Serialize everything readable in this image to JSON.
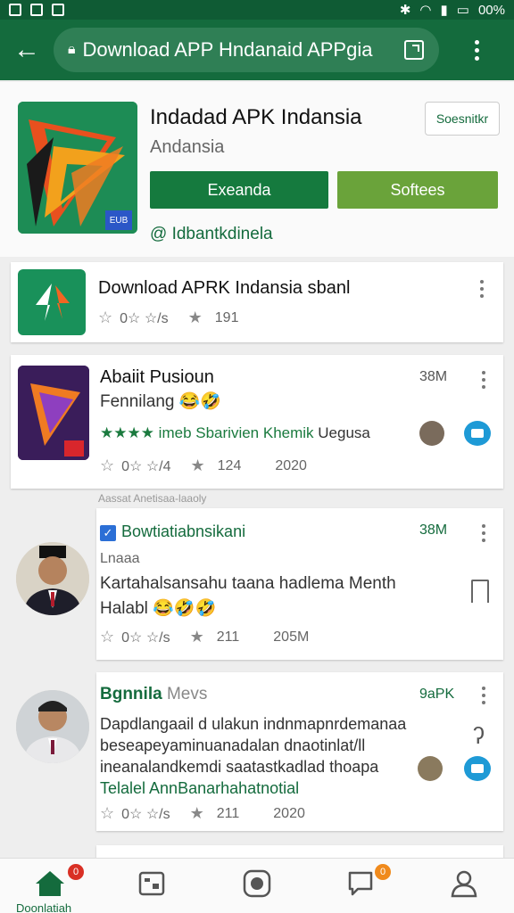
{
  "statusbar": {
    "right_text": "00%"
  },
  "appbar": {
    "url": "Download APP Hndanaid APPgia"
  },
  "header": {
    "title": "Indadad APK Indansia",
    "subtitle": "Andansia",
    "corner_button": "Soesnitkr",
    "primary_button": "Exeanda",
    "secondary_button": "Softees",
    "developer_link": "@ Idbantkdinela"
  },
  "cards": [
    {
      "title": "Download APRK Indansia sbanl",
      "rating_text": "0☆ ☆/s",
      "downloads": "191"
    },
    {
      "title": "Abaiit Pusioun",
      "size": "38M",
      "subtitle": "Fennilang",
      "emoji": "😂🤣",
      "promo": "★★★★ imeb Sbarivien Khemik",
      "promo_tail": "Uegusa",
      "rating_text": "0☆ ☆/4",
      "downloads": "124",
      "year": "2020"
    },
    {
      "title": "Bowtiatiabnsikani",
      "size": "38M",
      "label": "Lnaaa",
      "body_line1": "Kartahalsansahu taana hadlema Menth",
      "body_line2": "Halabl",
      "emoji": "😂🤣🤣",
      "rating_text": "0☆ ☆/s",
      "downloads": "211",
      "year": "205M"
    },
    {
      "title": "Bgnnila",
      "title_tail": "Mevs",
      "size": "9aPK",
      "body_line1": "Dapdlangaail d ulakun indnmapnrdemanaa",
      "body_line2": "beseapeyaminuanadalan dnaotinlat/ll",
      "body_line3": "ineanalandkemdi saatastkadlad thoapa",
      "body_line4": "Telalel AnnBanarhahatnotial",
      "rating_text": "0☆ ☆/s",
      "downloads": "211",
      "year": "2020"
    }
  ],
  "between_label": "Aassat Anetisaa-laaoly",
  "bottom_nav": {
    "home_label": "Doonlatiah",
    "home_badge": "0",
    "msg_badge": "0"
  },
  "colors": {
    "brand": "#146b3d",
    "primary_btn": "#157a3e",
    "secondary_btn": "#6aa33a",
    "download_badge": "#1e9ad6"
  }
}
